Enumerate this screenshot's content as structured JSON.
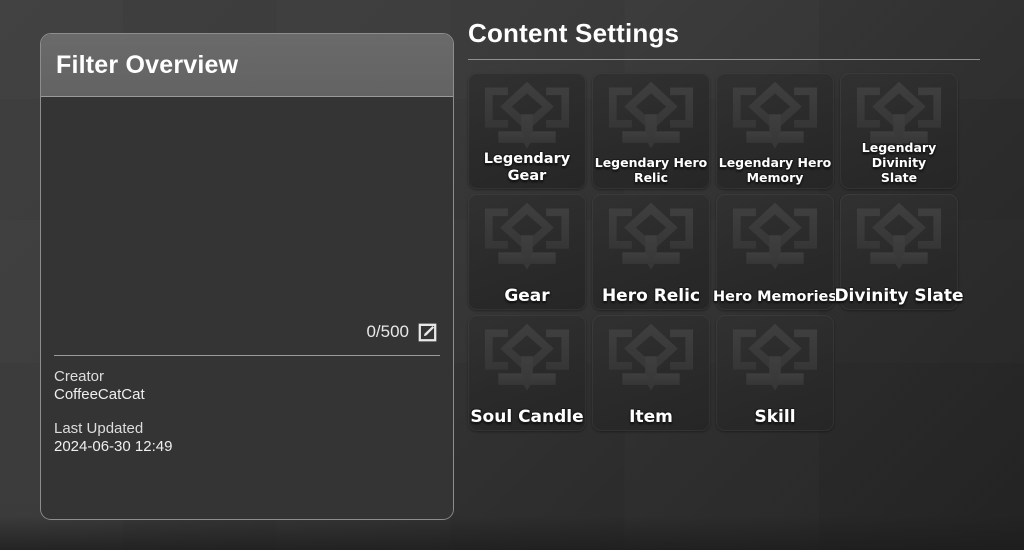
{
  "filter_panel": {
    "header_title": "Filter Overview",
    "note_text": "",
    "counter": "0/500",
    "edit_icon": "edit-pencil-square-icon",
    "creator_label": "Creator",
    "creator_value": "CoffeeCatCat",
    "last_updated_label": "Last Updated",
    "last_updated_value": "2024-06-30 12:49"
  },
  "content_settings": {
    "title": "Content Settings",
    "tiles": [
      {
        "label": "Legendary Gear",
        "size": "mid",
        "icon": "crest-emblem-icon"
      },
      {
        "label": "Legendary Hero\nRelic",
        "size": "small",
        "icon": "crest-emblem-icon"
      },
      {
        "label": "Legendary Hero\nMemory",
        "size": "small",
        "icon": "crest-emblem-icon"
      },
      {
        "label": "Legendary Divinity\nSlate",
        "size": "small",
        "icon": "crest-emblem-icon"
      },
      {
        "label": "Gear",
        "size": "big",
        "icon": "crest-emblem-icon"
      },
      {
        "label": "Hero Relic",
        "size": "big",
        "icon": "crest-emblem-icon"
      },
      {
        "label": "Hero Memories",
        "size": "mid",
        "icon": "crest-emblem-icon"
      },
      {
        "label": "Divinity Slate",
        "size": "big",
        "icon": "crest-emblem-icon"
      },
      {
        "label": "Soul Candle",
        "size": "big",
        "icon": "crest-emblem-icon"
      },
      {
        "label": "Item",
        "size": "big",
        "icon": "crest-emblem-icon"
      },
      {
        "label": "Skill",
        "size": "big",
        "icon": "crest-emblem-icon"
      }
    ]
  },
  "colors": {
    "background": "#3a3a3a",
    "panel_background": "#343434",
    "panel_header": "#666666",
    "panel_border": "#8d8d8d",
    "tile_background": "#2b2b2b",
    "text_primary": "#ffffff",
    "text_secondary": "#dddddd",
    "divider": "#9b9b9b"
  }
}
